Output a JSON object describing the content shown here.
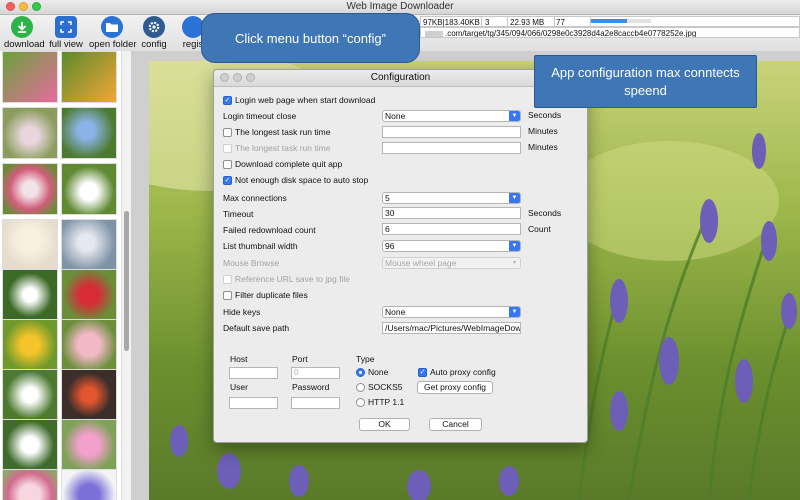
{
  "window": {
    "title": "Web Image Downloader"
  },
  "toolbar": {
    "download": "download",
    "full_view": "full view",
    "open_folder": "open folder",
    "config": "config",
    "register": "regis"
  },
  "status": {
    "size1": "97KB|183.40KB",
    "count": "3",
    "size2": "22.93 MB",
    "num": "77",
    "progress": 0.6
  },
  "url": ".com/target/tg/345/094/066/0298e0c3928d4a2e8caccb4e0778252e.jpg",
  "dialog": {
    "title": "Configuration",
    "login_web": "Login web page when start download",
    "login_timeout": "Login timeout close",
    "login_timeout_value": "None",
    "login_timeout_unit": "Seconds",
    "longest_task1": "The longest task run time",
    "longest_task1_unit": "Minutes",
    "longest_task2": "The longest task run time",
    "longest_task2_unit": "Minutes",
    "download_quit": "Download complete quit app",
    "disk_space": "Not enough disk space to auto stop",
    "max_conn": "Max connections",
    "max_conn_value": "5",
    "timeout": "Timeout",
    "timeout_value": "30",
    "timeout_unit": "Seconds",
    "failed_count": "Failed redownload count",
    "failed_count_value": "6",
    "failed_count_unit": "Count",
    "thumb_width": "List thumbnail width",
    "thumb_width_value": "96",
    "mouse_browse": "Mouse Browse",
    "mouse_browse_value": "Mouse wheel page",
    "reference_url": "Reference URL save to jpg file",
    "filter_dup": "Filter duplicate files",
    "hide_keys": "Hide keys",
    "hide_keys_value": "None",
    "save_path": "Default save path",
    "save_path_value": "/Users/mac/Pictures/WebImageDow",
    "proxy": {
      "host": "Host",
      "port": "Port",
      "port_placeholder": "0",
      "user": "User",
      "password": "Password",
      "type": "Type",
      "none": "None",
      "socks5": "SOCKS5",
      "http": "HTTP 1.1",
      "auto": "Auto proxy config",
      "get": "Get proxy config"
    },
    "ok": "OK",
    "cancel": "Cancel"
  },
  "callouts": {
    "config_tip": "Click menu button “config”",
    "max_tip": "App configuration max conntects speend"
  },
  "colors": {
    "accent": "#3478f6",
    "callout": "#3f76b5"
  }
}
